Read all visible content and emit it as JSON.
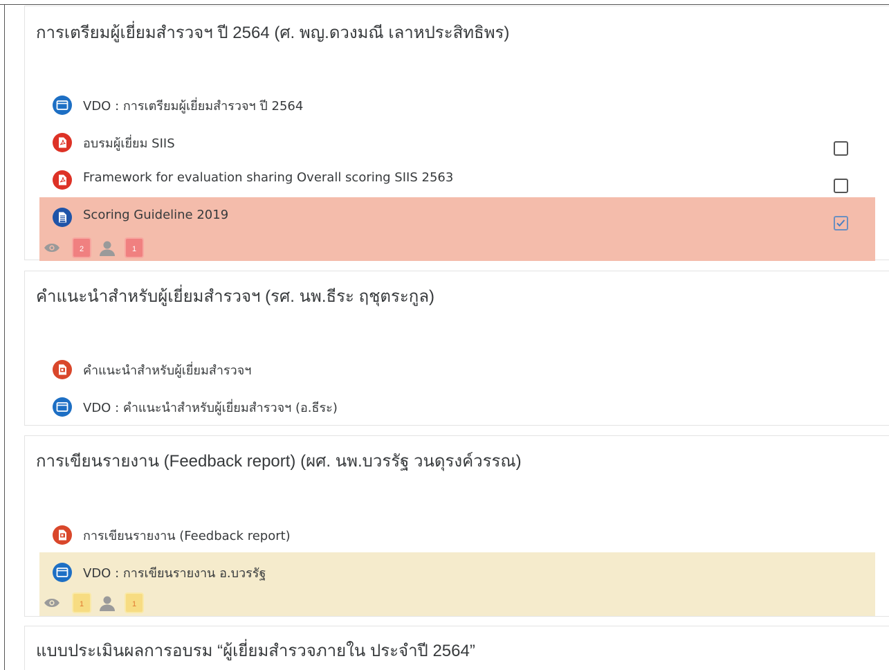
{
  "colors": {
    "video_icon": "#1d6fc4",
    "pdf_icon": "#dd3226",
    "ppt_icon": "#d9472b",
    "doc_icon": "#1f54a8",
    "highlight_red": "#f4bcab",
    "highlight_yellow": "#f5ebcc"
  },
  "sections": [
    {
      "title": "การเตรียมผู้เยี่ยมสำรวจฯ ปี 2564 (ศ. พญ.ดวงมณี เลาหประสิทธิพร)",
      "activities": [
        {
          "name": "VDO : การเตรียมผู้เยี่ยมสำรวจฯ ปี 2564",
          "icon": "video-icon"
        },
        {
          "name": "อบรมผู้เยี่ยม SIIS",
          "icon": "pdf-icon",
          "completion": "unchecked"
        },
        {
          "name": "Framework for evaluation sharing Overall scoring SIIS 2563",
          "icon": "pdf-icon",
          "completion": "unchecked"
        },
        {
          "name": "Scoring Guideline 2019",
          "icon": "document-icon",
          "completion": "checked",
          "views": "2",
          "users": "1"
        }
      ]
    },
    {
      "title": "คำแนะนำสำหรับผู้เยี่ยมสำรวจฯ (รศ. นพ.ธีระ ฤชุตระกูล)",
      "activities": [
        {
          "name": "คำแนะนำสำหรับผู้เยี่ยมสำรวจฯ",
          "icon": "presentation-icon"
        },
        {
          "name": "VDO : คำแนะนำสำหรับผู้เยี่ยมสำรวจฯ (อ.ธีระ)",
          "icon": "video-icon"
        }
      ]
    },
    {
      "title": "การเขียนรายงาน (Feedback report) (ผศ. นพ.บวรรัฐ วนดุรงค์วรรณ)",
      "activities": [
        {
          "name": "การเขียนรายงาน (Feedback report)",
          "icon": "presentation-icon"
        },
        {
          "name": "VDO : การเขียนรายงาน อ.บวรรัฐ",
          "icon": "video-icon",
          "views": "1",
          "users": "1"
        }
      ]
    },
    {
      "title": "แบบประเมินผลการอบรม “ผู้เยี่ยมสำรวจภายใน ประจำปี 2564”",
      "activities": []
    }
  ]
}
